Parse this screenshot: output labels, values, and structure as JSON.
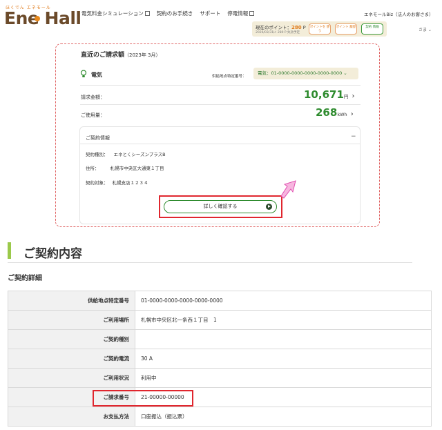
{
  "header": {
    "logo_ruby": "ほくでん エネモール",
    "logo_text": "Ene Hall",
    "nav": [
      "電気料金シミュレーション",
      "契約のお手続き",
      "サポート",
      "停電情報"
    ],
    "biz_link": "エネモールBiz（法人のお客さま）",
    "points_label": "現在のポイント：",
    "points_value": "280",
    "points_unit": "P",
    "points_note": "2026/03/31に 280 P 失効予定",
    "btn_exchange": "ポイントを 使う",
    "btn_history": "ポイント 履歴",
    "btn_mypage": "契約 情報",
    "user_suffix": "さま"
  },
  "billing": {
    "title": "直近のご請求額",
    "period": "（2023年 3月）",
    "service": "電気",
    "supply_label": "供給地点特定番号：",
    "supply_value": "電気：01-0000-0000-0000-0000-0000",
    "amount_label": "請求金額：",
    "amount_value": "10,671",
    "amount_unit": "円",
    "usage_label": "ご使用量：",
    "usage_value": "268",
    "usage_unit": "kWh"
  },
  "contract_info": {
    "title": "ご契約情報",
    "rows": [
      {
        "label": "契約種別：",
        "value": "エネとくシーズンプラスB"
      },
      {
        "label": "住所：",
        "value": "札幌市中央区大通東１丁目"
      },
      {
        "label": "契約対象：",
        "value": "札幌支店１２３４"
      }
    ],
    "detail_button": "詳しく確認する"
  },
  "contract_section": {
    "title": "ご契約内容",
    "subtitle": "ご契約詳細",
    "rows": [
      {
        "label": "供給地点特定番号",
        "value": "01-0000-0000-0000-0000-0000"
      },
      {
        "label": "ご利用場所",
        "value": "札幌市中央区北一条西１丁目　1"
      },
      {
        "label": "ご契約種別",
        "value": ""
      },
      {
        "label": "ご契約電流",
        "value": "30 A"
      },
      {
        "label": "ご利用状況",
        "value": "利用中"
      },
      {
        "label": "ご請求番号",
        "value": "21-00000-00000"
      },
      {
        "label": "お支払方法",
        "value": "口座振込（振込票）"
      }
    ]
  },
  "colors": {
    "accent_green": "#2e8b2e",
    "highlight_red": "#e0262e",
    "section_bar": "#9bc94a",
    "logo_orange": "#e8891c"
  }
}
